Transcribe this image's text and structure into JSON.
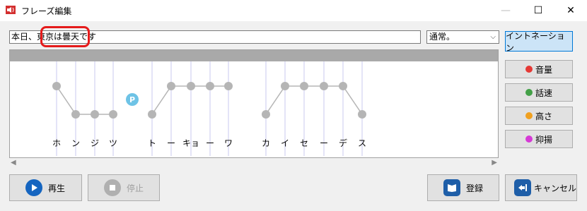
{
  "window": {
    "title": "フレーズ編集"
  },
  "phrase": {
    "text": "本日、東京は曇天です"
  },
  "mode": {
    "selected": "通常。"
  },
  "side_buttons": [
    {
      "label": "イントネーション",
      "color": ""
    },
    {
      "label": "音量",
      "color": "#e53935"
    },
    {
      "label": "話速",
      "color": "#43a047"
    },
    {
      "label": "高さ",
      "color": "#f0a020"
    },
    {
      "label": "抑揚",
      "color": "#d63ad6"
    }
  ],
  "pause_marker": "P",
  "moras": [
    "ホ",
    "ン",
    "ジ",
    "ツ",
    "ト",
    "ー",
    "キョ",
    "ー",
    "ワ",
    "カ",
    "イ",
    "セ",
    "ー",
    "デ",
    "ス"
  ],
  "bottom_buttons": {
    "play": "再生",
    "stop": "停止",
    "register": "登録",
    "cancel": "キャンセル"
  }
}
